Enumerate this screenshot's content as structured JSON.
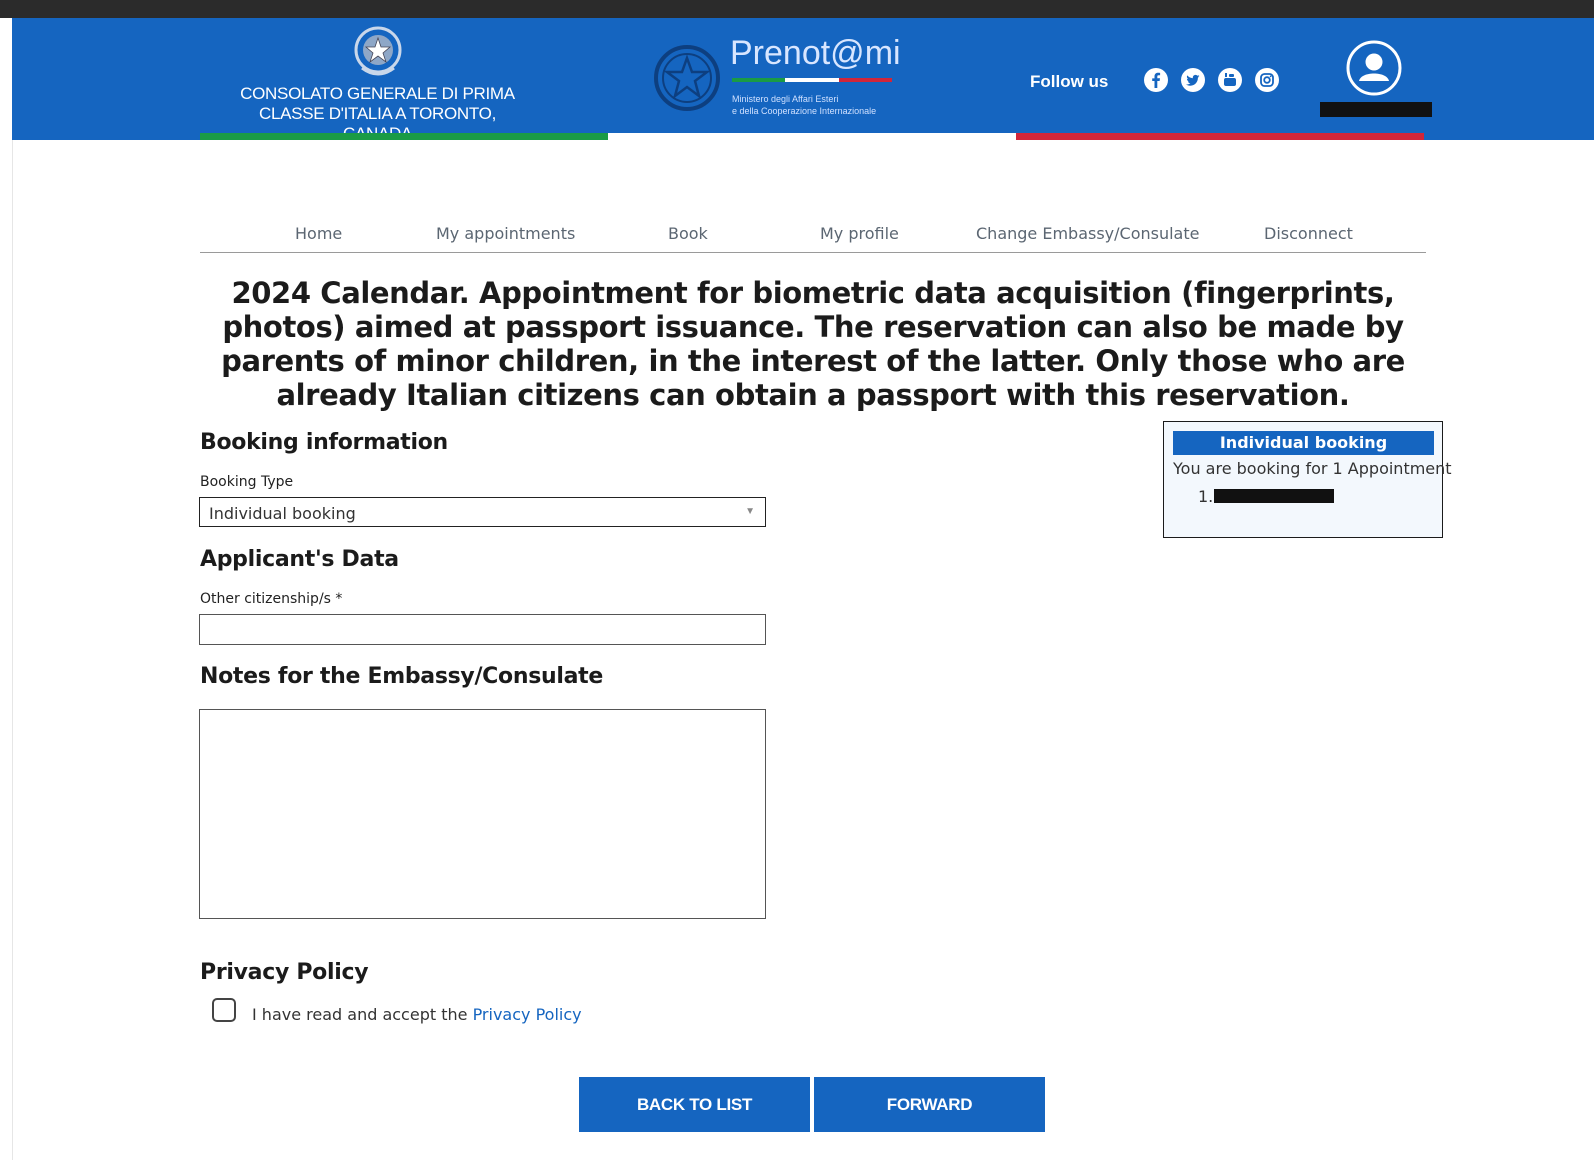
{
  "header": {
    "consulate_name": "CONSOLATO GENERALE DI PRIMA CLASSE D'ITALIA A TORONTO, CANADA",
    "brand_title": "Prenot@mi",
    "brand_subtitle_line1": "Ministero degli Affari Esteri",
    "brand_subtitle_line2": "e della Cooperazione Internazionale",
    "follow_label": "Follow us",
    "social_icons": [
      "facebook-icon",
      "twitter-icon",
      "youtube-icon",
      "instagram-icon"
    ],
    "colors": {
      "primary": "#1565c0",
      "flag_green": "#1a9b45",
      "flag_white": "#ffffff",
      "flag_red": "#d1263a"
    }
  },
  "nav": {
    "items": [
      {
        "label": "Home"
      },
      {
        "label": "My appointments"
      },
      {
        "label": "Book"
      },
      {
        "label": "My profile"
      },
      {
        "label": "Change Embassy/Consulate"
      },
      {
        "label": "Disconnect"
      }
    ]
  },
  "page_title": "2024 Calendar. Appointment for biometric data acquisition (fingerprints, photos) aimed at passport issuance. The reservation can also be made by parents of minor children, in the interest of the latter. Only those who are already Italian citizens can obtain a passport with this reservation.",
  "booking": {
    "section_title": "Booking information",
    "type_label": "Booking Type",
    "type_value": "Individual booking"
  },
  "applicant": {
    "section_title": "Applicant's Data",
    "citizenship_label": "Other citizenship/s *",
    "citizenship_value": ""
  },
  "notes": {
    "section_title": "Notes for the Embassy/Consulate",
    "value": ""
  },
  "summary": {
    "header": "Individual booking",
    "text": "You are booking for 1 Appointment",
    "item_number": "1."
  },
  "privacy": {
    "section_title": "Privacy Policy",
    "checkbox_text": "I have read and accept the",
    "link_text": "Privacy Policy"
  },
  "buttons": {
    "back": "BACK TO LIST",
    "forward": "FORWARD"
  }
}
